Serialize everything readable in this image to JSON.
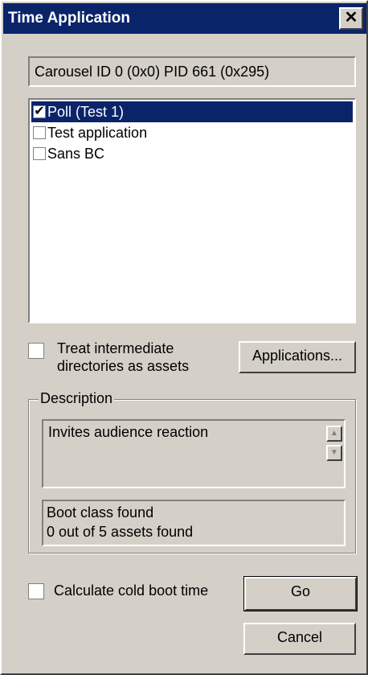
{
  "window": {
    "title": "Time Application",
    "close_glyph": "✕"
  },
  "carousel_info": "Carousel ID 0 (0x0) PID 661 (0x295)",
  "applications": [
    {
      "label": "Poll (Test 1)",
      "checked": true,
      "selected": true
    },
    {
      "label": "Test application",
      "checked": false,
      "selected": false
    },
    {
      "label": "Sans BC",
      "checked": false,
      "selected": false
    }
  ],
  "options": {
    "treat_dirs_line1": "Treat intermediate",
    "treat_dirs_line2": "directories as assets",
    "treat_dirs_checked": false,
    "applications_button": "Applications..."
  },
  "description": {
    "legend": "Description",
    "text": "Invites audience reaction",
    "status_line1": "Boot class found",
    "status_line2": "0 out of 5 assets found"
  },
  "footer": {
    "cold_boot_label": "Calculate cold boot time",
    "cold_boot_checked": false,
    "go_button": "Go",
    "cancel_button": "Cancel"
  },
  "icons": {
    "check": "✔",
    "scroll_up": "▲",
    "scroll_down": "▼"
  },
  "colors": {
    "titlebar": "#0a246a",
    "face": "#d4d0c8",
    "selection": "#0a246a"
  }
}
